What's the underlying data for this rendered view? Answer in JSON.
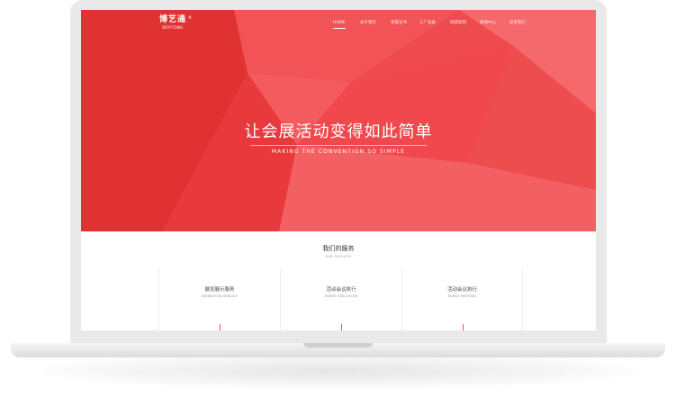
{
  "brand": {
    "logo_cn": "博艺通",
    "logo_en": "BOYITONG",
    "logo_mark": "®",
    "accent_color": "#ef4a4e"
  },
  "nav": {
    "items": [
      {
        "label": "HOME",
        "active": true
      },
      {
        "label": "关于我们",
        "active": false
      },
      {
        "label": "荣誉证书",
        "active": false
      },
      {
        "label": "工厂设备",
        "active": false
      },
      {
        "label": "经典案例",
        "active": false
      },
      {
        "label": "新闻中心",
        "active": false
      },
      {
        "label": "联系我们",
        "active": false
      }
    ]
  },
  "hero": {
    "title": "让会展活动变得如此简单",
    "subtitle": "MAKING THE CONVENTION SO SIMPLE"
  },
  "services": {
    "title": "我们的服务",
    "subtitle": "OUR SERVICES",
    "cards": [
      {
        "title": "展览展示服务",
        "subtitle": "EXHIBITION SERVICE"
      },
      {
        "title": "活动会议执行",
        "subtitle": "EVENT EXECUTION"
      },
      {
        "title": "活动会议执行",
        "subtitle": "EVENT MEETING"
      }
    ]
  }
}
